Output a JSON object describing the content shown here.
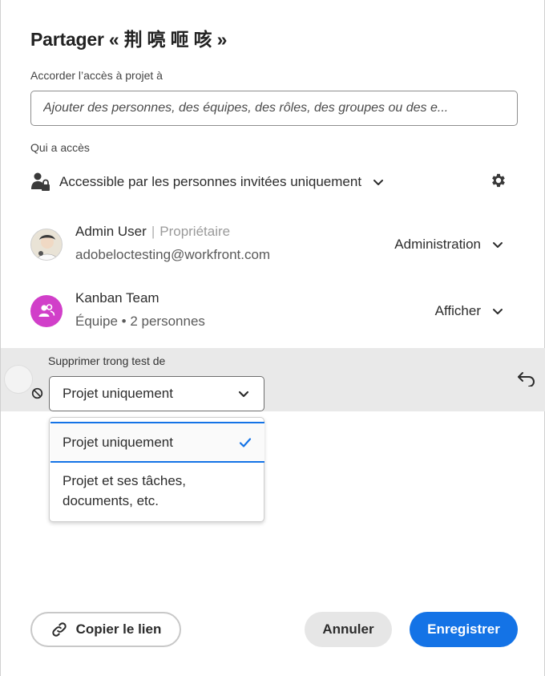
{
  "dialog": {
    "title": "Partager « 荆 喨 咂 咳 »"
  },
  "grant": {
    "label": "Accorder l’accès à projet à",
    "placeholder": "Ajouter des personnes, des équipes, des rôles, des groupes ou des e..."
  },
  "access": {
    "label": "Qui a accès",
    "setting": "Accessible par les personnes invitées uniquement"
  },
  "people": [
    {
      "name": "Admin User",
      "separator": "|",
      "role": "Propriétaire",
      "sub": "adobeloctesting@workfront.com",
      "permission": "Administration"
    },
    {
      "name": "Kanban Team",
      "sub": "Équipe • 2 personnes",
      "permission": "Afficher"
    }
  ],
  "removal": {
    "label": "Supprimer trong test de",
    "selected": "Projet uniquement",
    "options": [
      "Projet uniquement",
      "Projet et ses tâches, documents, etc."
    ]
  },
  "footer": {
    "copy_link": "Copier le lien",
    "cancel": "Annuler",
    "save": "Enregistrer"
  },
  "colors": {
    "accent": "#1473e6",
    "team_avatar": "#d13fc9",
    "band": "#e9e9e9"
  }
}
